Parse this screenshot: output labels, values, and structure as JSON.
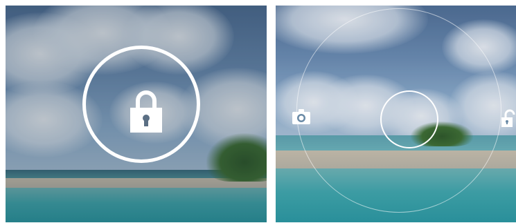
{
  "screens": {
    "left": {
      "state": "locked",
      "center_icon": "lock-icon"
    },
    "right": {
      "state": "unlock-ring",
      "left_target_icon": "camera-icon",
      "right_target_icon": "unlock-icon"
    }
  },
  "colors": {
    "ring": "#ffffff",
    "sky": "#6b8db3",
    "ocean": "#3fa7ad",
    "sand": "#c9c0ae"
  }
}
